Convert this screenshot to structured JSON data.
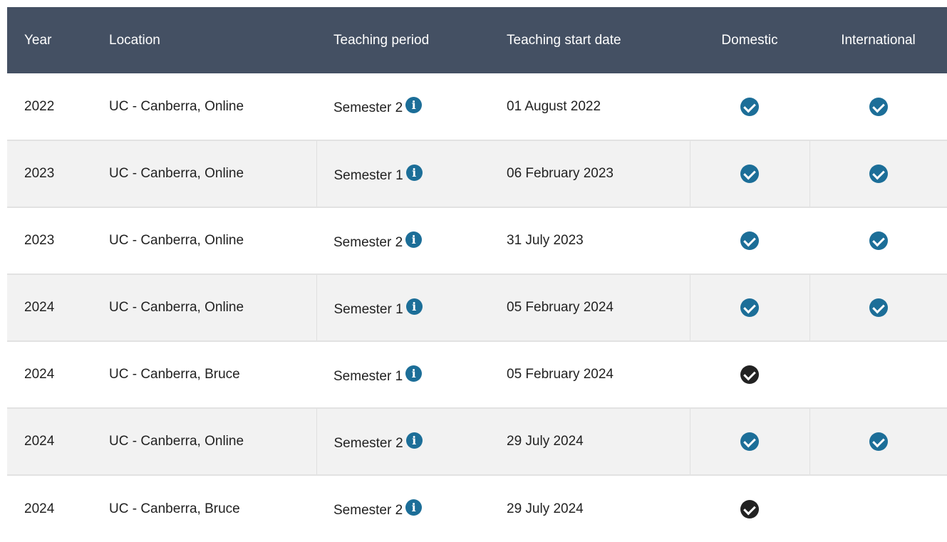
{
  "table": {
    "headers": {
      "year": "Year",
      "location": "Location",
      "period": "Teaching period",
      "start": "Teaching start date",
      "domestic": "Domestic",
      "international": "International"
    },
    "rows": [
      {
        "year": "2022",
        "location": "UC - Canberra, Online",
        "period": "Semester 2",
        "start": "01 August 2022",
        "domestic": "check-circle-blue-icon",
        "international": "check-circle-blue-icon"
      },
      {
        "year": "2023",
        "location": "UC - Canberra, Online",
        "period": "Semester 1",
        "start": "06 February 2023",
        "domestic": "check-circle-blue-icon",
        "international": "check-circle-blue-icon"
      },
      {
        "year": "2023",
        "location": "UC - Canberra, Online",
        "period": "Semester 2",
        "start": "31 July 2023",
        "domestic": "check-circle-blue-icon",
        "international": "check-circle-blue-icon"
      },
      {
        "year": "2024",
        "location": "UC - Canberra, Online",
        "period": "Semester 1",
        "start": "05 February 2024",
        "domestic": "check-circle-blue-icon",
        "international": "check-circle-blue-icon"
      },
      {
        "year": "2024",
        "location": "UC - Canberra, Bruce",
        "period": "Semester 1",
        "start": "05 February 2024",
        "domestic": "check-circle-black-icon",
        "international": ""
      },
      {
        "year": "2024",
        "location": "UC - Canberra, Online",
        "period": "Semester 2",
        "start": "29 July 2024",
        "domestic": "check-circle-blue-icon",
        "international": "check-circle-blue-icon"
      },
      {
        "year": "2024",
        "location": "UC - Canberra, Bruce",
        "period": "Semester 2",
        "start": "29 July 2024",
        "domestic": "check-circle-black-icon",
        "international": ""
      }
    ]
  },
  "icons": {
    "info": "i",
    "info_icon_name": "info-circle-icon"
  },
  "colors": {
    "header_bg": "#445063",
    "accent_blue": "#1c6e98",
    "check_black": "#222222",
    "row_alt": "#f2f2f2"
  }
}
